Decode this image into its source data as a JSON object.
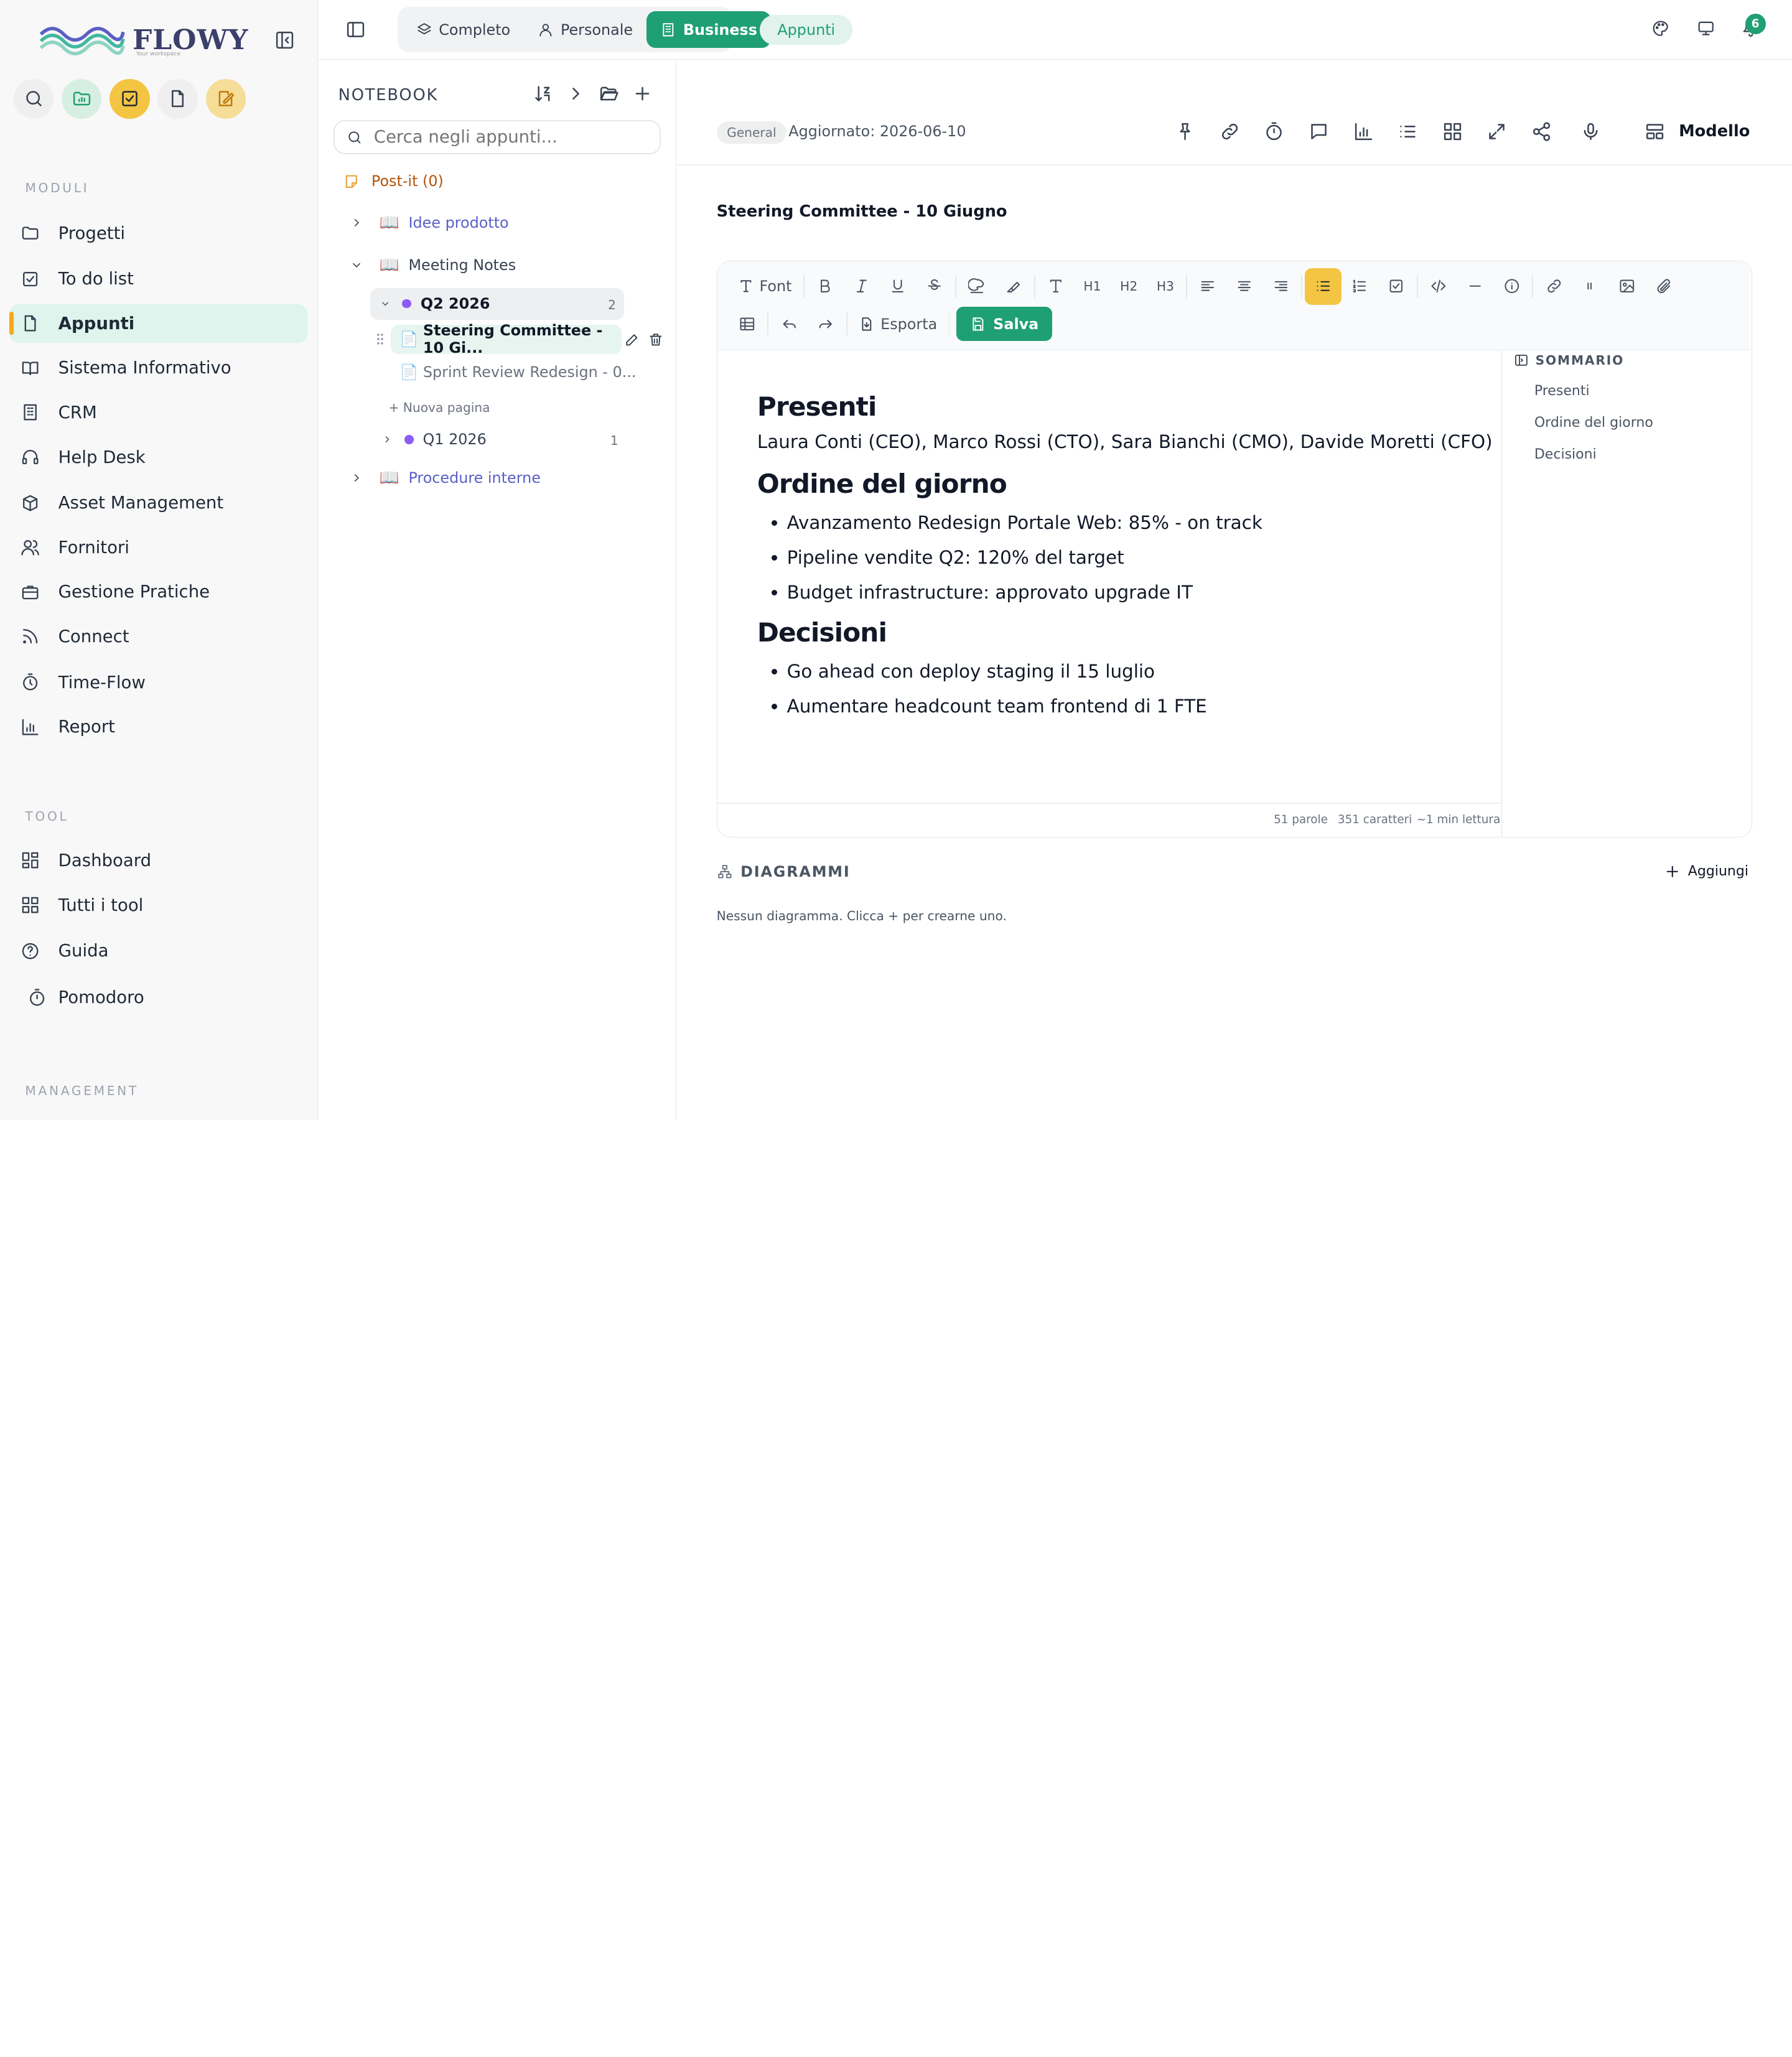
{
  "brand": {
    "name": "FLOWY",
    "tagline": "Your workspace"
  },
  "sidebar": {
    "modules_label": "MODULI",
    "modules": [
      {
        "label": "Progetti",
        "icon": "folder-icon"
      },
      {
        "label": "To do list",
        "icon": "check-square-icon"
      },
      {
        "label": "Appunti",
        "icon": "note-icon",
        "active": true
      },
      {
        "label": "Sistema Informativo",
        "icon": "book-icon"
      },
      {
        "label": "CRM",
        "icon": "building-icon"
      },
      {
        "label": "Help Desk",
        "icon": "headset-icon"
      },
      {
        "label": "Asset Management",
        "icon": "box-icon"
      },
      {
        "label": "Fornitori",
        "icon": "users-icon"
      },
      {
        "label": "Gestione Pratiche",
        "icon": "briefcase-icon"
      },
      {
        "label": "Connect",
        "icon": "rss-icon"
      },
      {
        "label": "Time-Flow",
        "icon": "timer-icon"
      },
      {
        "label": "Report",
        "icon": "bar-chart-icon"
      }
    ],
    "tool_label": "TOOL",
    "tools": [
      {
        "label": "Dashboard",
        "icon": "dashboard-icon"
      },
      {
        "label": "Tutti i tool",
        "icon": "grid-icon"
      },
      {
        "label": "Guida",
        "icon": "help-icon"
      }
    ],
    "pomodoro": "Pomodoro",
    "management_label": "MANAGEMENT"
  },
  "topbar": {
    "segments": [
      {
        "label": "Completo",
        "icon": "layers-icon"
      },
      {
        "label": "Personale",
        "icon": "user-icon"
      },
      {
        "label": "Business",
        "icon": "building-icon",
        "active": true
      }
    ],
    "context_pill": "Appunti",
    "notifications_count": "6"
  },
  "notebook": {
    "title": "NOTEBOOK",
    "search_placeholder": "Cerca negli appunti...",
    "postit": "Post-it (0)",
    "notebooks": {
      "idee": "Idee prodotto",
      "meeting": "Meeting Notes",
      "procedure": "Procedure interne"
    },
    "sections": {
      "q2": {
        "label": "Q2 2026",
        "count": "2"
      },
      "q1": {
        "label": "Q1 2026",
        "count": "1"
      }
    },
    "pages": {
      "active": "Steering Committee - 10 Gi...",
      "second": "Sprint Review Redesign - 0..."
    },
    "new_page": "+ Nuova pagina"
  },
  "main": {
    "tag": "General",
    "updated": "Aggiornato: 2026-06-10",
    "template_label": "Modello",
    "doc_title": "Steering Committee - 10 Giugno",
    "toolbar": {
      "font": "Font",
      "export": "Esporta",
      "save": "Salva",
      "h1": "H1",
      "h2": "H2",
      "h3": "H3"
    },
    "content": {
      "h_presenti": "Presenti",
      "presenti_text": "Laura Conti (CEO), Marco Rossi (CTO), Sara Bianchi (CMO), Davide Moretti (CFO)",
      "h_ordine": "Ordine del giorno",
      "ordine_items": [
        "Avanzamento Redesign Portale Web: 85% - on track",
        "Pipeline vendite Q2: 120% del target",
        "Budget infrastructure: approvato upgrade IT"
      ],
      "h_decisioni": "Decisioni",
      "decisioni_items": [
        "Go ahead con deploy staging il 15 luglio",
        "Aumentare headcount team frontend di 1 FTE"
      ]
    },
    "stats": {
      "words": "51 parole",
      "chars": "351 caratteri",
      "read": "~1 min lettura"
    },
    "toc": {
      "title": "SOMMARIO",
      "items": [
        "Presenti",
        "Ordine del giorno",
        "Decisioni"
      ]
    },
    "diagrams": {
      "title": "DIAGRAMMI",
      "add": "Aggiungi",
      "empty": "Nessun diagramma. Clicca + per crearne uno."
    }
  }
}
